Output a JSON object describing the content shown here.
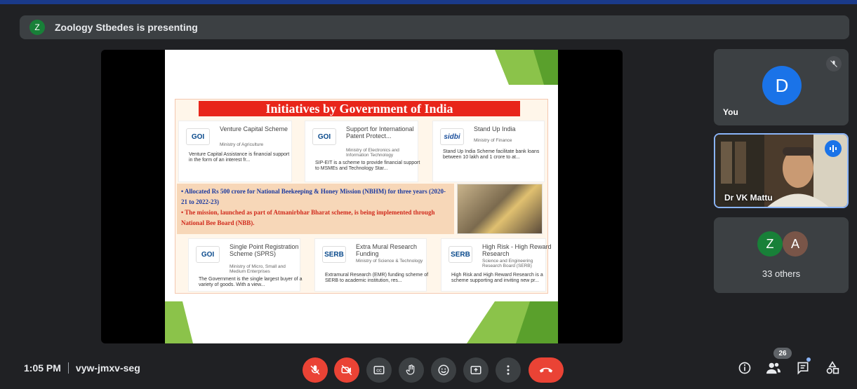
{
  "presenter": {
    "initial": "Z",
    "text": "Zoology Stbedes is presenting"
  },
  "slide": {
    "title": "Initiatives by Government of India",
    "cards_top": [
      {
        "logo": "GOI",
        "title": "Venture Capital Scheme",
        "ministry": "Ministry of Agriculture",
        "desc": "Venture Capital Assistance is financial support in the form of an interest fr..."
      },
      {
        "logo": "GOI",
        "title": "Support for International Patent Protect...",
        "ministry": "Ministry of Electronics and Information Technology",
        "desc": "SIP-EIT is a scheme to provide financial support to MSMEs and Technology Star..."
      },
      {
        "logo": "sidbi",
        "title": "Stand Up India",
        "ministry": "Ministry of Finance",
        "desc": "Stand Up India Scheme facilitate bank loans between 10 lakh and 1 crore to at..."
      }
    ],
    "bullet1": "Allocated Rs 500 crore for National Beekeeping & Honey Mission (NBHM) for three years (2020-21 to 2022-23)",
    "bullet2": "The mission, launched as part of Atmanirbhar Bharat scheme, is being implemented through National Bee Board (NBB).",
    "cards_bottom": [
      {
        "logo": "GOI",
        "title": "Single Point Registration Scheme (SPRS)",
        "ministry": "Ministry of Micro, Small and Medium Enterprises",
        "desc": "The Government is the single largest buyer of a variety of goods. With a view..."
      },
      {
        "logo": "SERB",
        "title": "Extra Mural Research Funding",
        "ministry": "Ministry of Science & Technology",
        "desc": "Extramural Research (EMR) funding scheme of SERB to academic institution, res..."
      },
      {
        "logo": "SERB",
        "title": "High Risk - High Reward Research",
        "ministry": "Science and Engineering Research Board (SERB)",
        "desc": "High Risk and High Reward Research is a scheme supporting and inviting new pr..."
      }
    ]
  },
  "participants": {
    "you": {
      "initial": "D",
      "label": "You"
    },
    "speaker": {
      "label": "Dr VK Mattu"
    },
    "others": {
      "initial1": "Z",
      "initial2": "A",
      "label": "33 others"
    }
  },
  "bottom": {
    "time": "1:05 PM",
    "code": "vyw-jmxv-seg",
    "people_count": "26"
  },
  "colors": {
    "accent": "#1a73e8",
    "danger": "#ea4335",
    "bg": "#202124",
    "tile": "#3c4043",
    "presenter": "#188038"
  }
}
